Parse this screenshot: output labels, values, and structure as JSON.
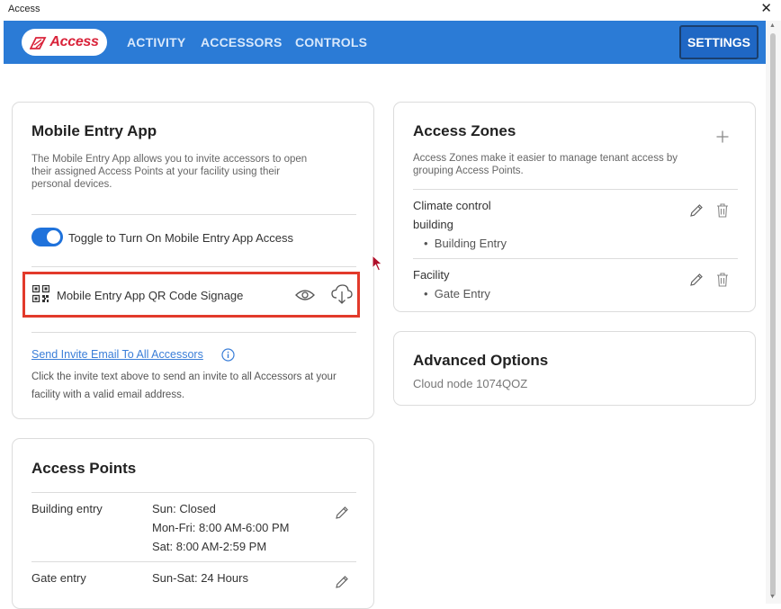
{
  "window": {
    "title": "Access",
    "close_glyph": "✕"
  },
  "nav": {
    "logo_text": "Access",
    "links": [
      "ACTIVITY",
      "ACCESSORS",
      "CONTROLS"
    ],
    "settings_label": "SETTINGS",
    "bg_color": "#2b7bd6"
  },
  "mobile_entry": {
    "title": "Mobile Entry App",
    "description_lines": [
      "The Mobile Entry App allows you to invite accessors to open",
      "their assigned Access Points at your facility using their",
      "personal devices."
    ],
    "toggle_label": "Toggle to Turn On Mobile Entry App Access",
    "toggle_on": true,
    "qr_label": "Mobile Entry App QR Code Signage",
    "invite_link": "Send Invite Email To All Accessors",
    "invite_help_lines": [
      "Click the invite text above to send an invite to all Accessors at your",
      "facility with a valid email address."
    ]
  },
  "access_zones": {
    "title": "Access Zones",
    "description_lines": [
      "Access Zones make it easier to manage tenant access by",
      "grouping Access Points."
    ],
    "zones": [
      {
        "name_lines": [
          "Climate control",
          "building"
        ],
        "points": [
          "Building Entry"
        ]
      },
      {
        "name_lines": [
          "Facility"
        ],
        "points": [
          "Gate Entry"
        ]
      }
    ]
  },
  "advanced": {
    "title": "Advanced Options",
    "cloud_node": "Cloud node 1074QOZ"
  },
  "access_points": {
    "title": "Access Points",
    "points": [
      {
        "name": "Building entry",
        "schedule": [
          "Sun: Closed",
          "Mon-Fri: 8:00 AM-6:00 PM",
          "Sat: 8:00 AM-2:59 PM"
        ]
      },
      {
        "name": "Gate entry",
        "schedule": [
          "Sun-Sat: 24 Hours"
        ]
      }
    ]
  }
}
